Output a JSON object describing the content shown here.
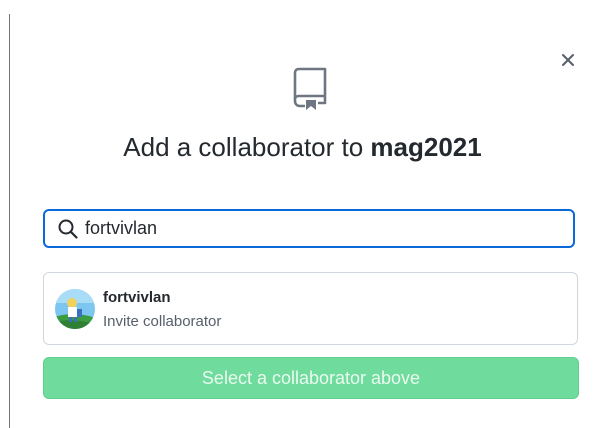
{
  "dialog": {
    "title_prefix": "Add a collaborator to ",
    "repo_name": "mag2021",
    "close_icon": "close-icon",
    "header_icon": "repo-icon"
  },
  "search": {
    "value": "fortvivlan",
    "icon": "search-icon"
  },
  "results": [
    {
      "username": "fortvivlan",
      "action": "Invite collaborator",
      "avatar": "avatar"
    }
  ],
  "select_button": {
    "label": "Select a collaborator above",
    "state": "disabled"
  },
  "colors": {
    "focus_border": "#0969da",
    "button_disabled_bg": "#6fdc9d",
    "text_primary": "#24292f",
    "text_secondary": "#57606a"
  }
}
